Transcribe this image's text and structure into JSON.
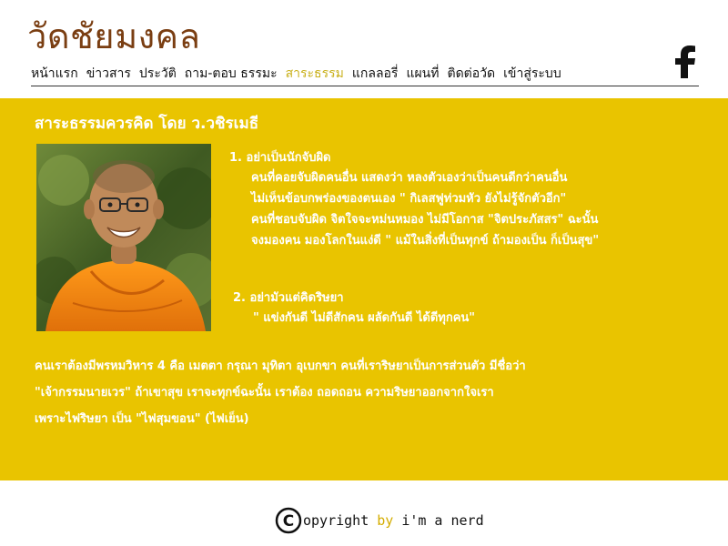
{
  "site": {
    "title": "วัดชัยมงคล"
  },
  "nav": {
    "items": [
      {
        "label": "หน้าแรก"
      },
      {
        "label": "ข่าวสาร"
      },
      {
        "label": "ประวัติ"
      },
      {
        "label": "ถาม-ตอบ ธรรมะ"
      },
      {
        "label": "สาระธรรม"
      },
      {
        "label": "แกลลอรี่"
      },
      {
        "label": "แผนที่"
      },
      {
        "label": "ติดต่อวัด"
      },
      {
        "label": "เข้าสู่ระบบ"
      }
    ],
    "active_index": 4
  },
  "social": {
    "facebook_icon": "facebook-icon"
  },
  "article": {
    "title": "สาระธรรมควรคิด โดย ว.วชิรเมธี",
    "points": [
      {
        "title": "1. อย่าเป็นนักจับผิด",
        "lines": [
          "คนที่คอยจับผิดคนอื่น แสดงว่า หลงตัวเองว่าเป็นคนดีกว่าคนอื่น",
          "ไม่เห็นข้อบกพร่องของตนเอง \" กิเลสฟูท่วมหัว ยังไม่รู้จักตัวอีก\"",
          "คนที่ชอบจับผิด จิตใจจะหม่นหมอง ไม่มีโอกาส \"จิตประภัสสร\" ฉะนั้น",
          "จงมองคน มองโลกในแง่ดี \" แม้ในสิ่งที่เป็นทุกข์ ถ้ามองเป็น ก็เป็นสุข\""
        ]
      },
      {
        "title": "2. อย่ามัวแต่คิดริษยา",
        "lines": [
          "\" แข่งกันดี ไม่ดีสักคน ผลัดกันดี ได้ดีทุกคน\""
        ]
      }
    ],
    "conclusion": [
      "คนเราต้องมีพรหมวิหาร 4 คือ เมตตา กรุณา มุทิตา อุเบกขา คนที่เราริษยาเป็นการส่วนตัว มีชื่อว่า",
      "\"เจ้ากรรมนายเวร\" ถ้าเขาสุข เราจะทุกข์ฉะนั้น เราต้อง ถอดถอน ความริษยาออกจากใจเรา",
      "เพราะไฟริษยา เป็น \"ไฟสุมขอน\" (ไฟเย็น)"
    ]
  },
  "footer": {
    "copyright_symbol": "C",
    "copyright_word": "opyright",
    "by_word": "by",
    "author": "i'm a nerd"
  },
  "colors": {
    "title_brown": "#7a3e12",
    "content_yellow": "#e9c400",
    "active_nav": "#c9b01a",
    "footer_by": "#d4ad00"
  }
}
